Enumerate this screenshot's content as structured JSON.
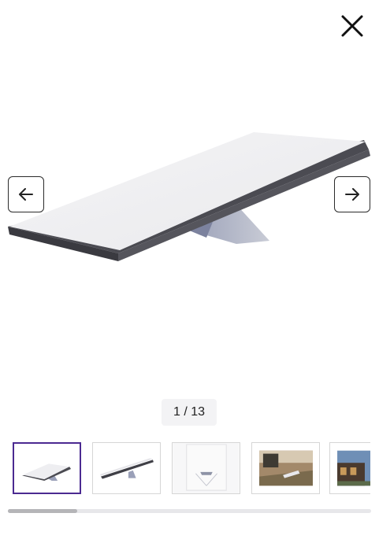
{
  "gallery": {
    "counter": "1 / 13",
    "current_index": 1,
    "total": 13,
    "scroll_fraction": 0.19
  },
  "icons": {
    "close": "close-icon",
    "prev": "arrow-left-icon",
    "next": "arrow-right-icon"
  },
  "colors": {
    "selected_border": "#4b2a91",
    "counter_bg": "#f3f3f5",
    "scroll_track": "#e7e7ea",
    "scroll_thumb": "#b5b5b8"
  }
}
